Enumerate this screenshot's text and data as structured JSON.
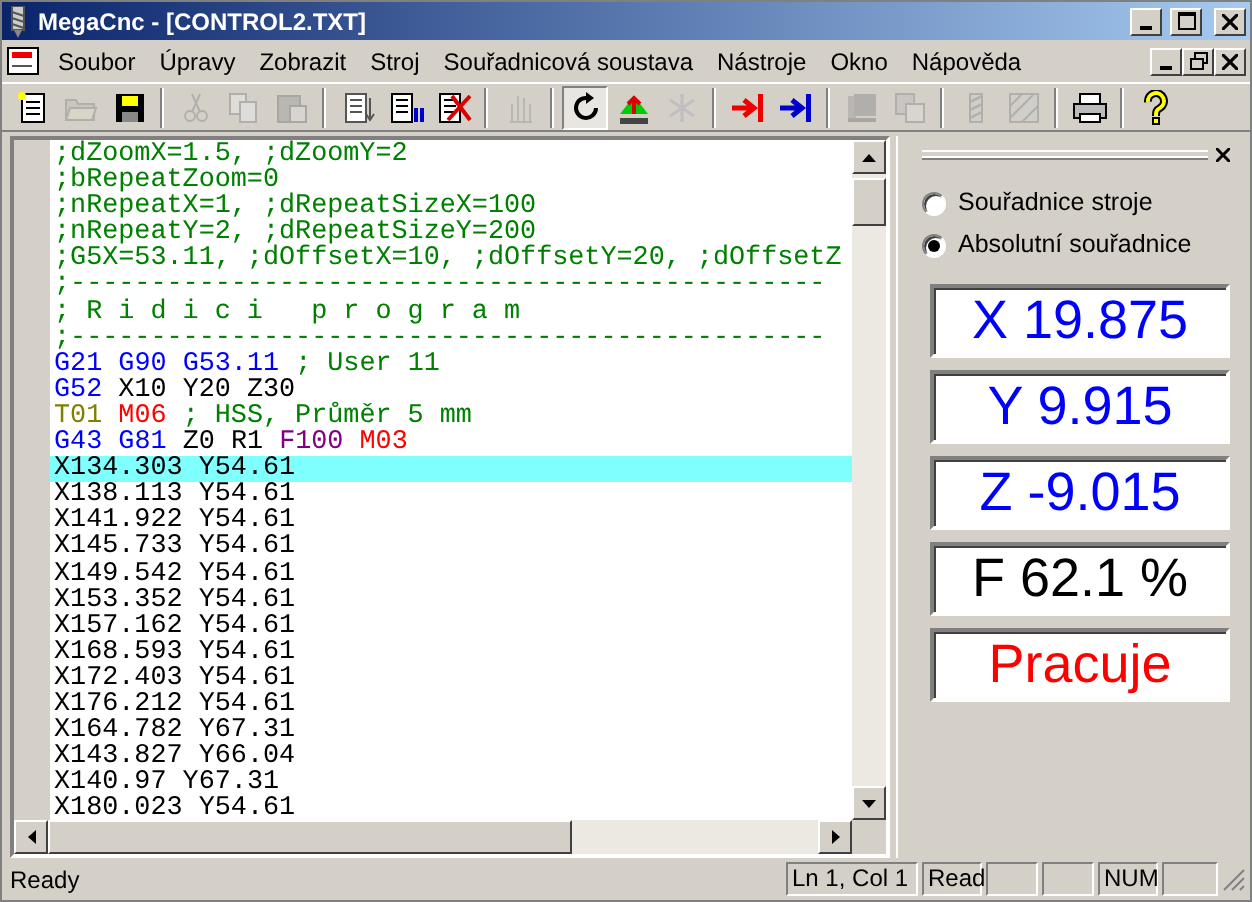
{
  "window": {
    "title": "MegaCnc - [CONTROL2.TXT]"
  },
  "menu": [
    "Soubor",
    "Úpravy",
    "Zobrazit",
    "Stroj",
    "Souřadnicová soustava",
    "Nástroje",
    "Okno",
    "Nápověda"
  ],
  "toolbar": [
    {
      "pressed": false,
      "disabled": false
    },
    {
      "pressed": false,
      "disabled": true
    },
    {
      "pressed": false,
      "disabled": false
    },
    {
      "pressed": false,
      "disabled": true
    },
    {
      "pressed": false,
      "disabled": true
    },
    {
      "pressed": false,
      "disabled": true
    },
    {
      "pressed": false,
      "disabled": false
    },
    {
      "pressed": false,
      "disabled": false
    },
    {
      "pressed": false,
      "disabled": false
    },
    {
      "pressed": false,
      "disabled": true
    },
    {
      "pressed": true,
      "disabled": false
    },
    {
      "pressed": false,
      "disabled": false
    },
    {
      "pressed": false,
      "disabled": true
    },
    {
      "pressed": false,
      "disabled": false
    },
    {
      "pressed": false,
      "disabled": false
    },
    {
      "pressed": false,
      "disabled": true
    },
    {
      "pressed": false,
      "disabled": true
    },
    {
      "pressed": false,
      "disabled": true
    },
    {
      "pressed": false,
      "disabled": true
    },
    {
      "pressed": false,
      "disabled": false
    },
    {
      "pressed": false,
      "disabled": false
    }
  ],
  "editor": {
    "lines": [
      {
        "selected": false,
        "tokens": [
          {
            "kind": "comment",
            "text": ";dZoomX=1.5, ;dZoomY=2"
          }
        ]
      },
      {
        "selected": false,
        "tokens": [
          {
            "kind": "comment",
            "text": ";bRepeatZoom=0"
          }
        ]
      },
      {
        "selected": false,
        "tokens": [
          {
            "kind": "comment",
            "text": ";nRepeatX=1, ;dRepeatSizeX=100"
          }
        ]
      },
      {
        "selected": false,
        "tokens": [
          {
            "kind": "comment",
            "text": ";nRepeatY=2, ;dRepeatSizeY=200"
          }
        ]
      },
      {
        "selected": false,
        "tokens": [
          {
            "kind": "comment",
            "text": ";G5X=53.11, ;dOffsetX=10, ;dOffsetY=20, ;dOffsetZ"
          }
        ]
      },
      {
        "selected": false,
        "tokens": [
          {
            "kind": "comment",
            "text": ";-----------------------------------------------"
          }
        ]
      },
      {
        "selected": false,
        "tokens": [
          {
            "kind": "comment",
            "text": "; R i d i c i   p r o g r a m"
          }
        ]
      },
      {
        "selected": false,
        "tokens": [
          {
            "kind": "comment",
            "text": ";-----------------------------------------------"
          }
        ]
      },
      {
        "selected": false,
        "tokens": [
          {
            "kind": "gcode",
            "text": "G21"
          },
          {
            "kind": "gcode",
            "text": "G90"
          },
          {
            "kind": "gcode",
            "text": "G53.11"
          },
          {
            "kind": "comment",
            "text": "; User 11"
          }
        ]
      },
      {
        "selected": false,
        "tokens": [
          {
            "kind": "gcode",
            "text": "G52"
          },
          {
            "kind": "coord",
            "text": "X10"
          },
          {
            "kind": "coord",
            "text": "Y20"
          },
          {
            "kind": "coord",
            "text": "Z30"
          }
        ]
      },
      {
        "selected": false,
        "tokens": [
          {
            "kind": "tool",
            "text": "T01"
          },
          {
            "kind": "mcode",
            "text": "M06"
          },
          {
            "kind": "comment",
            "text": "; HSS, Průměr 5 mm"
          }
        ]
      },
      {
        "selected": false,
        "tokens": [
          {
            "kind": "gcode",
            "text": "G43"
          },
          {
            "kind": "gcode",
            "text": "G81"
          },
          {
            "kind": "coord",
            "text": "Z0"
          },
          {
            "kind": "coord",
            "text": "R1"
          },
          {
            "kind": "feed",
            "text": "F100"
          },
          {
            "kind": "mcode",
            "text": "M03"
          }
        ]
      },
      {
        "selected": true,
        "tokens": [
          {
            "kind": "coord",
            "text": "X134.303"
          },
          {
            "kind": "coord",
            "text": "Y54.61"
          }
        ]
      },
      {
        "selected": false,
        "tokens": [
          {
            "kind": "coord",
            "text": "X138.113"
          },
          {
            "kind": "coord",
            "text": "Y54.61"
          }
        ]
      },
      {
        "selected": false,
        "tokens": [
          {
            "kind": "coord",
            "text": "X141.922"
          },
          {
            "kind": "coord",
            "text": "Y54.61"
          }
        ]
      },
      {
        "selected": false,
        "tokens": [
          {
            "kind": "coord",
            "text": "X145.733"
          },
          {
            "kind": "coord",
            "text": "Y54.61"
          }
        ]
      },
      {
        "selected": false,
        "tokens": [
          {
            "kind": "coord",
            "text": "X149.542"
          },
          {
            "kind": "coord",
            "text": "Y54.61"
          }
        ]
      },
      {
        "selected": false,
        "tokens": [
          {
            "kind": "coord",
            "text": "X153.352"
          },
          {
            "kind": "coord",
            "text": "Y54.61"
          }
        ]
      },
      {
        "selected": false,
        "tokens": [
          {
            "kind": "coord",
            "text": "X157.162"
          },
          {
            "kind": "coord",
            "text": "Y54.61"
          }
        ]
      },
      {
        "selected": false,
        "tokens": [
          {
            "kind": "coord",
            "text": "X168.593"
          },
          {
            "kind": "coord",
            "text": "Y54.61"
          }
        ]
      },
      {
        "selected": false,
        "tokens": [
          {
            "kind": "coord",
            "text": "X172.403"
          },
          {
            "kind": "coord",
            "text": "Y54.61"
          }
        ]
      },
      {
        "selected": false,
        "tokens": [
          {
            "kind": "coord",
            "text": "X176.212"
          },
          {
            "kind": "coord",
            "text": "Y54.61"
          }
        ]
      },
      {
        "selected": false,
        "tokens": [
          {
            "kind": "coord",
            "text": "X164.782"
          },
          {
            "kind": "coord",
            "text": "Y67.31"
          }
        ]
      },
      {
        "selected": false,
        "tokens": [
          {
            "kind": "coord",
            "text": "X143.827"
          },
          {
            "kind": "coord",
            "text": "Y66.04"
          }
        ]
      },
      {
        "selected": false,
        "tokens": [
          {
            "kind": "coord",
            "text": "X140.97"
          },
          {
            "kind": "coord",
            "text": "Y67.31"
          }
        ]
      },
      {
        "selected": false,
        "tokens": [
          {
            "kind": "coord",
            "text": "X180.023"
          },
          {
            "kind": "coord",
            "text": "Y54.61"
          }
        ]
      }
    ]
  },
  "panel": {
    "coordinate_modes": [
      {
        "label": "Souřadnice stroje",
        "selected": false
      },
      {
        "label": "Absolutní souřadnice",
        "selected": true
      }
    ],
    "readouts": [
      {
        "text": "X 19.875",
        "color": "#0000ff"
      },
      {
        "text": "Y 9.915",
        "color": "#0000ff"
      },
      {
        "text": "Z -9.015",
        "color": "#0000ff"
      },
      {
        "text": "F 62.1 %",
        "color": "#000000"
      },
      {
        "text": "Pracuje",
        "color": "#ff0000"
      }
    ]
  },
  "status_bar": {
    "message": "Ready",
    "position": "Ln 1, Col 1",
    "mode": "Read",
    "num_lock": "NUM"
  }
}
